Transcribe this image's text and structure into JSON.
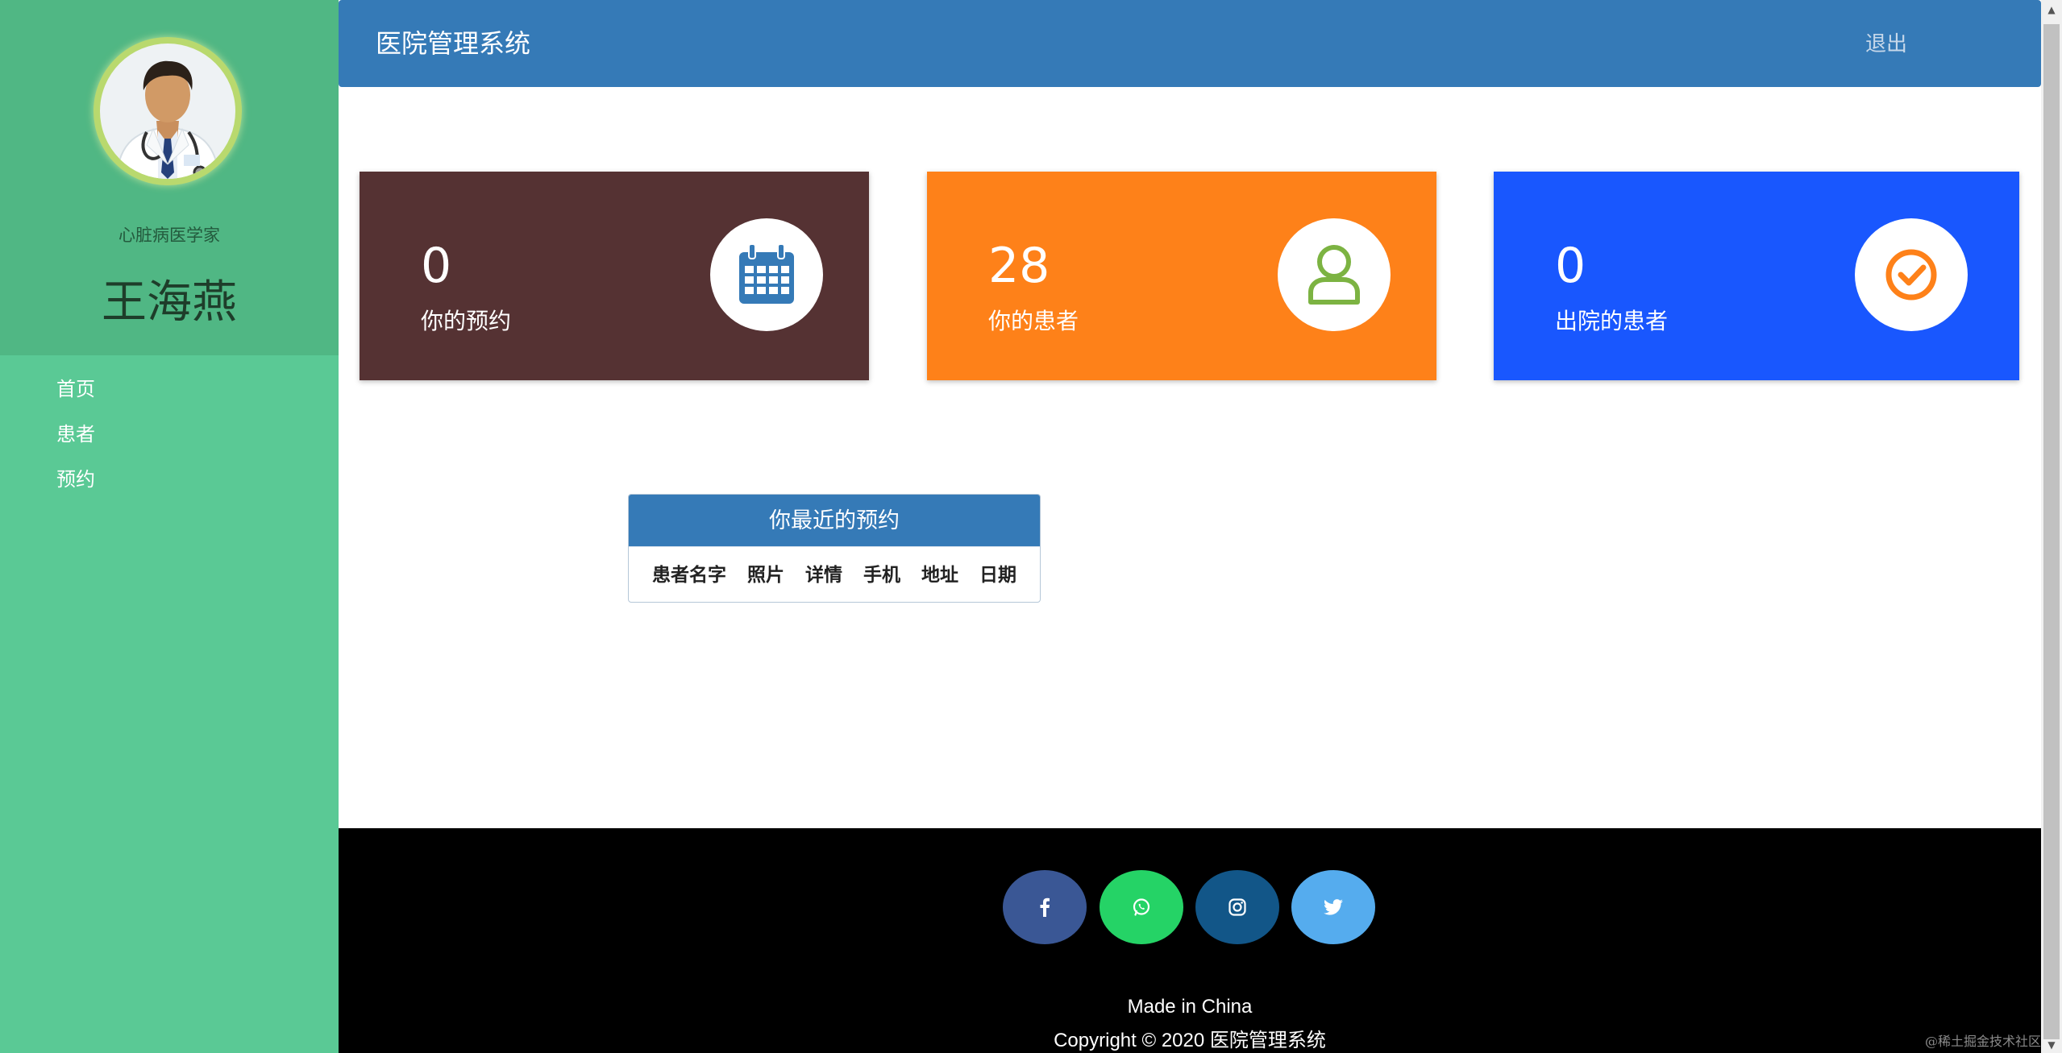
{
  "app": {
    "title": "医院管理系统",
    "logout_label": "退出"
  },
  "profile": {
    "specialty": "心脏病医学家",
    "name": "王海燕"
  },
  "nav": {
    "items": [
      {
        "label": "首页"
      },
      {
        "label": "患者"
      },
      {
        "label": "预约"
      }
    ]
  },
  "stats": [
    {
      "value": "0",
      "label": "你的预约",
      "icon": "calendar-icon",
      "color": "#553233",
      "icon_color": "#357ab7"
    },
    {
      "value": "28",
      "label": "你的患者",
      "icon": "user-icon",
      "color": "#fe8119",
      "icon_color": "#7cb342"
    },
    {
      "value": "0",
      "label": "出院的患者",
      "icon": "check-circle-icon",
      "color": "#1957fe",
      "icon_color": "#fe8119"
    }
  ],
  "recent": {
    "title": "你最近的预约",
    "columns": [
      "患者名字",
      "照片",
      "详情",
      "手机",
      "地址",
      "日期"
    ]
  },
  "footer": {
    "social": [
      "facebook-icon",
      "whatsapp-icon",
      "instagram-icon",
      "twitter-icon"
    ],
    "made": "Made in China",
    "copyright": "Copyright © 2020 医院管理系统"
  },
  "watermark": "@稀土掘金技术社区"
}
